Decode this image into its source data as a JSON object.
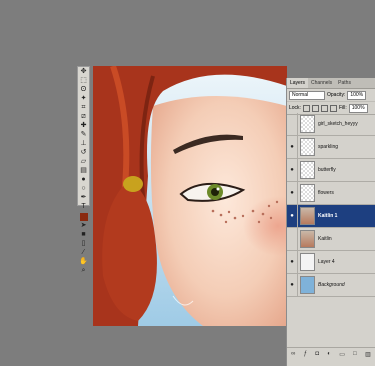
{
  "tools": [
    "move-icon",
    "marquee-icon",
    "lasso-icon",
    "magic-wand-icon",
    "crop-icon",
    "slice-icon",
    "healing-icon",
    "brush-icon",
    "stamp-icon",
    "history-icon",
    "eraser-icon",
    "gradient-icon",
    "blur-icon",
    "dodge-icon",
    "pen-icon",
    "type-icon",
    "path-select-icon",
    "shape-icon",
    "notes-icon",
    "eyedropper-icon",
    "hand-icon",
    "zoom-icon"
  ],
  "colors": {
    "foreground": "#8a2a10",
    "background": "#ffffff",
    "selected_layer": "#1d3f80"
  },
  "panel": {
    "tabs": [
      "Layers",
      "Channels",
      "Paths"
    ],
    "blend_mode": "Normal",
    "opacity_label": "Opacity:",
    "opacity_value": "100%",
    "lock_label": "Lock:",
    "fill_label": "Fill:",
    "fill_value": "100%",
    "layers": [
      {
        "name": "girl_sketch_heyyy",
        "visible": false,
        "thumb": "checker"
      },
      {
        "name": "sparkling",
        "visible": true,
        "thumb": "checker"
      },
      {
        "name": "butterfly",
        "visible": true,
        "thumb": "checker"
      },
      {
        "name": "flowers",
        "visible": true,
        "thumb": "checker"
      },
      {
        "name": "Kaitlin 1",
        "visible": true,
        "thumb": "face",
        "selected": true
      },
      {
        "name": "Kaitlin",
        "visible": false,
        "thumb": "face"
      },
      {
        "name": "Layer 4",
        "visible": true,
        "thumb": "white"
      },
      {
        "name": "Background",
        "visible": true,
        "thumb": "blue"
      }
    ]
  }
}
